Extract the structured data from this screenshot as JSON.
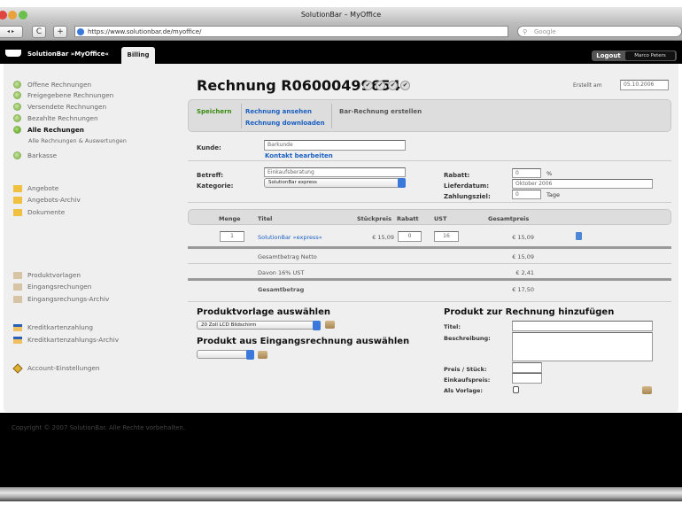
{
  "browser": {
    "title": "SolutionBar – MyOffice",
    "url": "https://www.solutionbar.de/myoffice/",
    "search_placeholder": "Google",
    "back": "◂ ▸",
    "reload": "C",
    "new_tab": "+"
  },
  "app": {
    "brand": "SolutionBar »MyOffice«",
    "tab": "Billing",
    "logout": "Logout",
    "user": "Marco Peters"
  },
  "sidebar": {
    "invoices": [
      "Offene Rechnungen",
      "Freigegebene Rechnungen",
      "Versendete Rechnungen",
      "Bezahlte Rechnungen",
      "Alle Rechungen"
    ],
    "sub": "Alle Rechnungen & Auswertungen",
    "cash": "Barkasse",
    "docs": [
      "Angebote",
      "Angebots-Archiv",
      "Dokumente"
    ],
    "products": [
      "Produktvorlagen",
      "Eingangsrechungen",
      "Eingangsrechungs-Archiv"
    ],
    "cards": [
      "Kreditkartenzahlung",
      "Kreditkartenzahlungs-Archiv"
    ],
    "account": "Account-Einstellungen"
  },
  "invoice": {
    "title": "Rechnung R06000499654",
    "created_label": "Erstellt am",
    "created": "05.10.2006",
    "actions": {
      "save": "Speichern",
      "view": "Rechnung ansehen",
      "download": "Rechnung downloaden",
      "cash_invoice": "Bar-Rechnung erstellen"
    },
    "customer_label": "Kunde:",
    "customer": "Barkunde",
    "edit_contact": "Kontakt bearbeiten",
    "subject_label": "Betreff:",
    "subject": "Einkaufsberatung",
    "category_label": "Kategorie:",
    "category": "SolutionBar express",
    "discount_label": "Rabatt:",
    "discount": "0",
    "percent": "%",
    "delivery_label": "Lieferdatum:",
    "delivery": "Oktober 2006",
    "payment_label": "Zahlungsziel:",
    "payment": "0",
    "days": "Tage"
  },
  "table": {
    "headers": [
      "Menge",
      "Titel",
      "Stückpreis",
      "Rabatt",
      "UST",
      "Gesamtpreis"
    ],
    "rows": [
      {
        "qty": "1",
        "title": "SolutionBar »express«",
        "unit": "€ 15,09",
        "discount": "0",
        "vat": "16",
        "total": "€ 15,09"
      }
    ],
    "net_label": "Gesamtbetrag Netto",
    "net": "€ 15,09",
    "vat_label": "Davon 16% UST",
    "vat": "€ 2,41",
    "total_label": "Gesamtbetrag",
    "total": "€ 17,50"
  },
  "templates": {
    "heading": "Produktvorlage auswählen",
    "selected": "20 Zoll LCD Bildschirm",
    "incoming_heading": "Produkt aus Eingangsrechnung auswählen",
    "incoming_selected": ""
  },
  "add_product": {
    "heading": "Produkt zur Rechnung hinzufügen",
    "title_label": "Titel:",
    "desc_label": "Beschreibung:",
    "price_label": "Preis / Stück:",
    "purchase_label": "Einkaufspreis:",
    "template_label": "Als Vorlage:"
  },
  "footer": "Copyright © 2007 SolutionBar. Alle Rechte vorbehalten."
}
